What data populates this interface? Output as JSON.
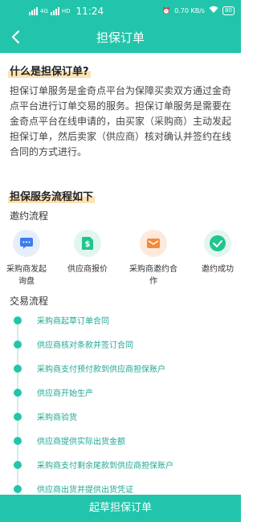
{
  "status_bar": {
    "network_left": "4G",
    "network_mid": "HD",
    "time": "11:24",
    "speed": "0.70 KB/s",
    "battery": "80"
  },
  "nav": {
    "title": "担保订单"
  },
  "intro": {
    "title": "什么是担保订单?",
    "description": "担保订单服务是金奇点平台为保障买卖双方通过金奇点平台进行订单交易的服务。担保订单服务是需要在金奇点平台在线申请的，由买家（采购商）主动发起担保订单，然后卖家（供应商）核对确认并签约在线合同的方式进行。"
  },
  "flow": {
    "title": "担保服务流程如下",
    "invite": {
      "title": "邀约流程",
      "steps": [
        {
          "label": "采购商发起询盘",
          "icon": "chat-icon",
          "bg": "#e6eefc",
          "fg": "#3d7bf0"
        },
        {
          "label": "供应商报价",
          "icon": "dollar-doc-icon",
          "bg": "#e2f6ef",
          "fg": "#22c58c"
        },
        {
          "label": "采购商邀约合作",
          "icon": "mail-icon",
          "bg": "#fdeadc",
          "fg": "#f48a3a"
        },
        {
          "label": "邀约成功",
          "icon": "check-icon",
          "bg": "#e2f6ef",
          "fg": "#22c58c"
        }
      ]
    },
    "trade": {
      "title": "交易流程",
      "items": [
        "采购商起草订单合同",
        "供应商核对条款并签订合同",
        "采购商支付预付款到供应商担保账户",
        "供应商开始生产",
        "采购商验货",
        "供应商提供实际出货金额",
        "采购商支付剩余尾款到供应商担保账户",
        "供应商出货并提供出货凭证"
      ]
    }
  },
  "bottom_button": {
    "label": "起草担保订单"
  },
  "colors": {
    "accent": "#22c5ab",
    "highlight": "#fde2b3"
  }
}
